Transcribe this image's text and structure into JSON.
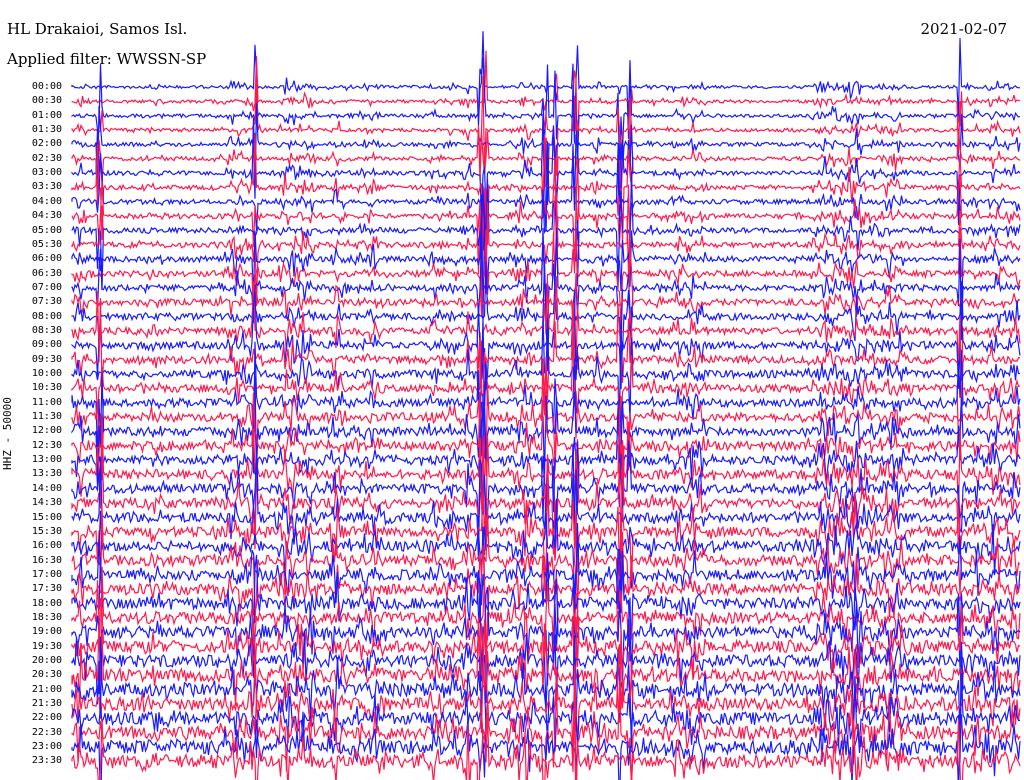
{
  "station": "HL Drakaioi, Samos Isl.",
  "date": "2021-02-07",
  "filter": "Applied filter: WWSSN-SP",
  "channel_label": "HHZ - 50000",
  "colors": {
    "trace_a": "#1a1aff",
    "trace_b": "#ff1a4d"
  },
  "chart_data": {
    "type": "line",
    "traces": [
      "00:00",
      "00:30",
      "01:00",
      "01:30",
      "02:00",
      "02:30",
      "03:00",
      "03:30",
      "04:00",
      "04:30",
      "05:00",
      "05:30",
      "06:00",
      "06:30",
      "07:00",
      "07:30",
      "08:00",
      "08:30",
      "09:00",
      "09:30",
      "10:00",
      "10:30",
      "11:00",
      "11:30",
      "12:00",
      "12:30",
      "13:00",
      "13:30",
      "14:00",
      "14:30",
      "15:00",
      "15:30",
      "16:00",
      "16:30",
      "17:00",
      "17:30",
      "18:00",
      "18:30",
      "19:00",
      "19:30",
      "20:00",
      "20:30",
      "21:00",
      "21:30",
      "22:00",
      "22:30",
      "23:00",
      "23:30"
    ]
  }
}
